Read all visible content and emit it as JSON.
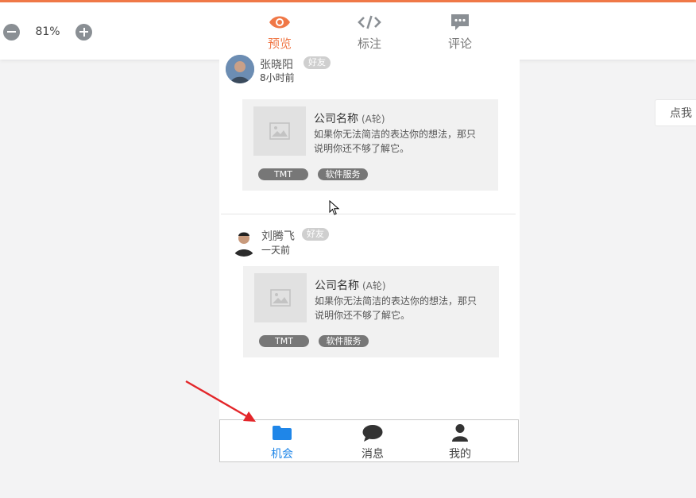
{
  "colors": {
    "accent": "#f07847",
    "nav_active": "#1f86e8",
    "arrow": "#e3262a"
  },
  "toolbar": {
    "zoom_value": "81%",
    "zoom_out_icon": "minus-circle-icon",
    "zoom_in_icon": "plus-circle-icon"
  },
  "tabs": [
    {
      "label": "预览",
      "icon": "eye-icon",
      "active": true
    },
    {
      "label": "标注",
      "icon": "code-icon",
      "active": false
    },
    {
      "label": "评论",
      "icon": "comment-icon",
      "active": false
    }
  ],
  "side_panel": {
    "label": "点我"
  },
  "feed": [
    {
      "user": "张晓阳",
      "badge": "好友",
      "time": "8小时前",
      "company": "公司名称",
      "round": "(A轮)",
      "desc": "如果你无法简洁的表达你的想法，那只说明你还不够了解它。",
      "tags": [
        "TMT",
        "软件服务"
      ]
    },
    {
      "user": "刘腾飞",
      "badge": "好友",
      "time": "一天前",
      "company": "公司名称",
      "round": "(A轮)",
      "desc": "如果你无法简洁的表达你的想法，那只说明你还不够了解它。",
      "tags": [
        "TMT",
        "软件服务"
      ]
    }
  ],
  "bottom_nav": [
    {
      "label": "机会",
      "icon": "folder-icon",
      "active": true
    },
    {
      "label": "消息",
      "icon": "chat-bubble-icon",
      "active": false
    },
    {
      "label": "我的",
      "icon": "user-icon",
      "active": false
    }
  ]
}
